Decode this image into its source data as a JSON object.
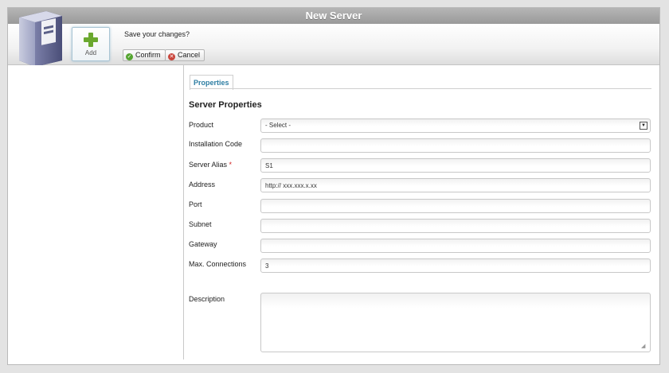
{
  "window": {
    "title": "New Server"
  },
  "toolbar": {
    "add_label": "Add",
    "prompt": "Save your changes?",
    "confirm_label": "Confirm",
    "cancel_label": "Cancel"
  },
  "tabs": [
    {
      "label": "Properties",
      "active": true
    }
  ],
  "section_title": "Server Properties",
  "fields": {
    "product": {
      "label": "Product",
      "value": "- Select -"
    },
    "installation_code": {
      "label": "Installation Code",
      "value": ""
    },
    "server_alias": {
      "label": "Server Alias",
      "required_mark": "*",
      "value": "S1"
    },
    "address": {
      "label": "Address",
      "value": "http:// xxx.xxx.x.xx"
    },
    "port": {
      "label": "Port",
      "value": ""
    },
    "subnet": {
      "label": "Subnet",
      "value": ""
    },
    "gateway": {
      "label": "Gateway",
      "value": ""
    },
    "max_connections": {
      "label": "Max. Connections",
      "value": "3"
    },
    "description": {
      "label": "Description",
      "value": ""
    }
  },
  "colors": {
    "confirm": "#55a530",
    "cancel": "#c9443b",
    "tab_text": "#2e7ea3",
    "add_plus": "#6aa82f"
  },
  "icons": [
    "server-icon",
    "plus-icon",
    "check-icon",
    "x-icon",
    "dropdown-arrow-icon",
    "resize-grip-icon"
  ]
}
